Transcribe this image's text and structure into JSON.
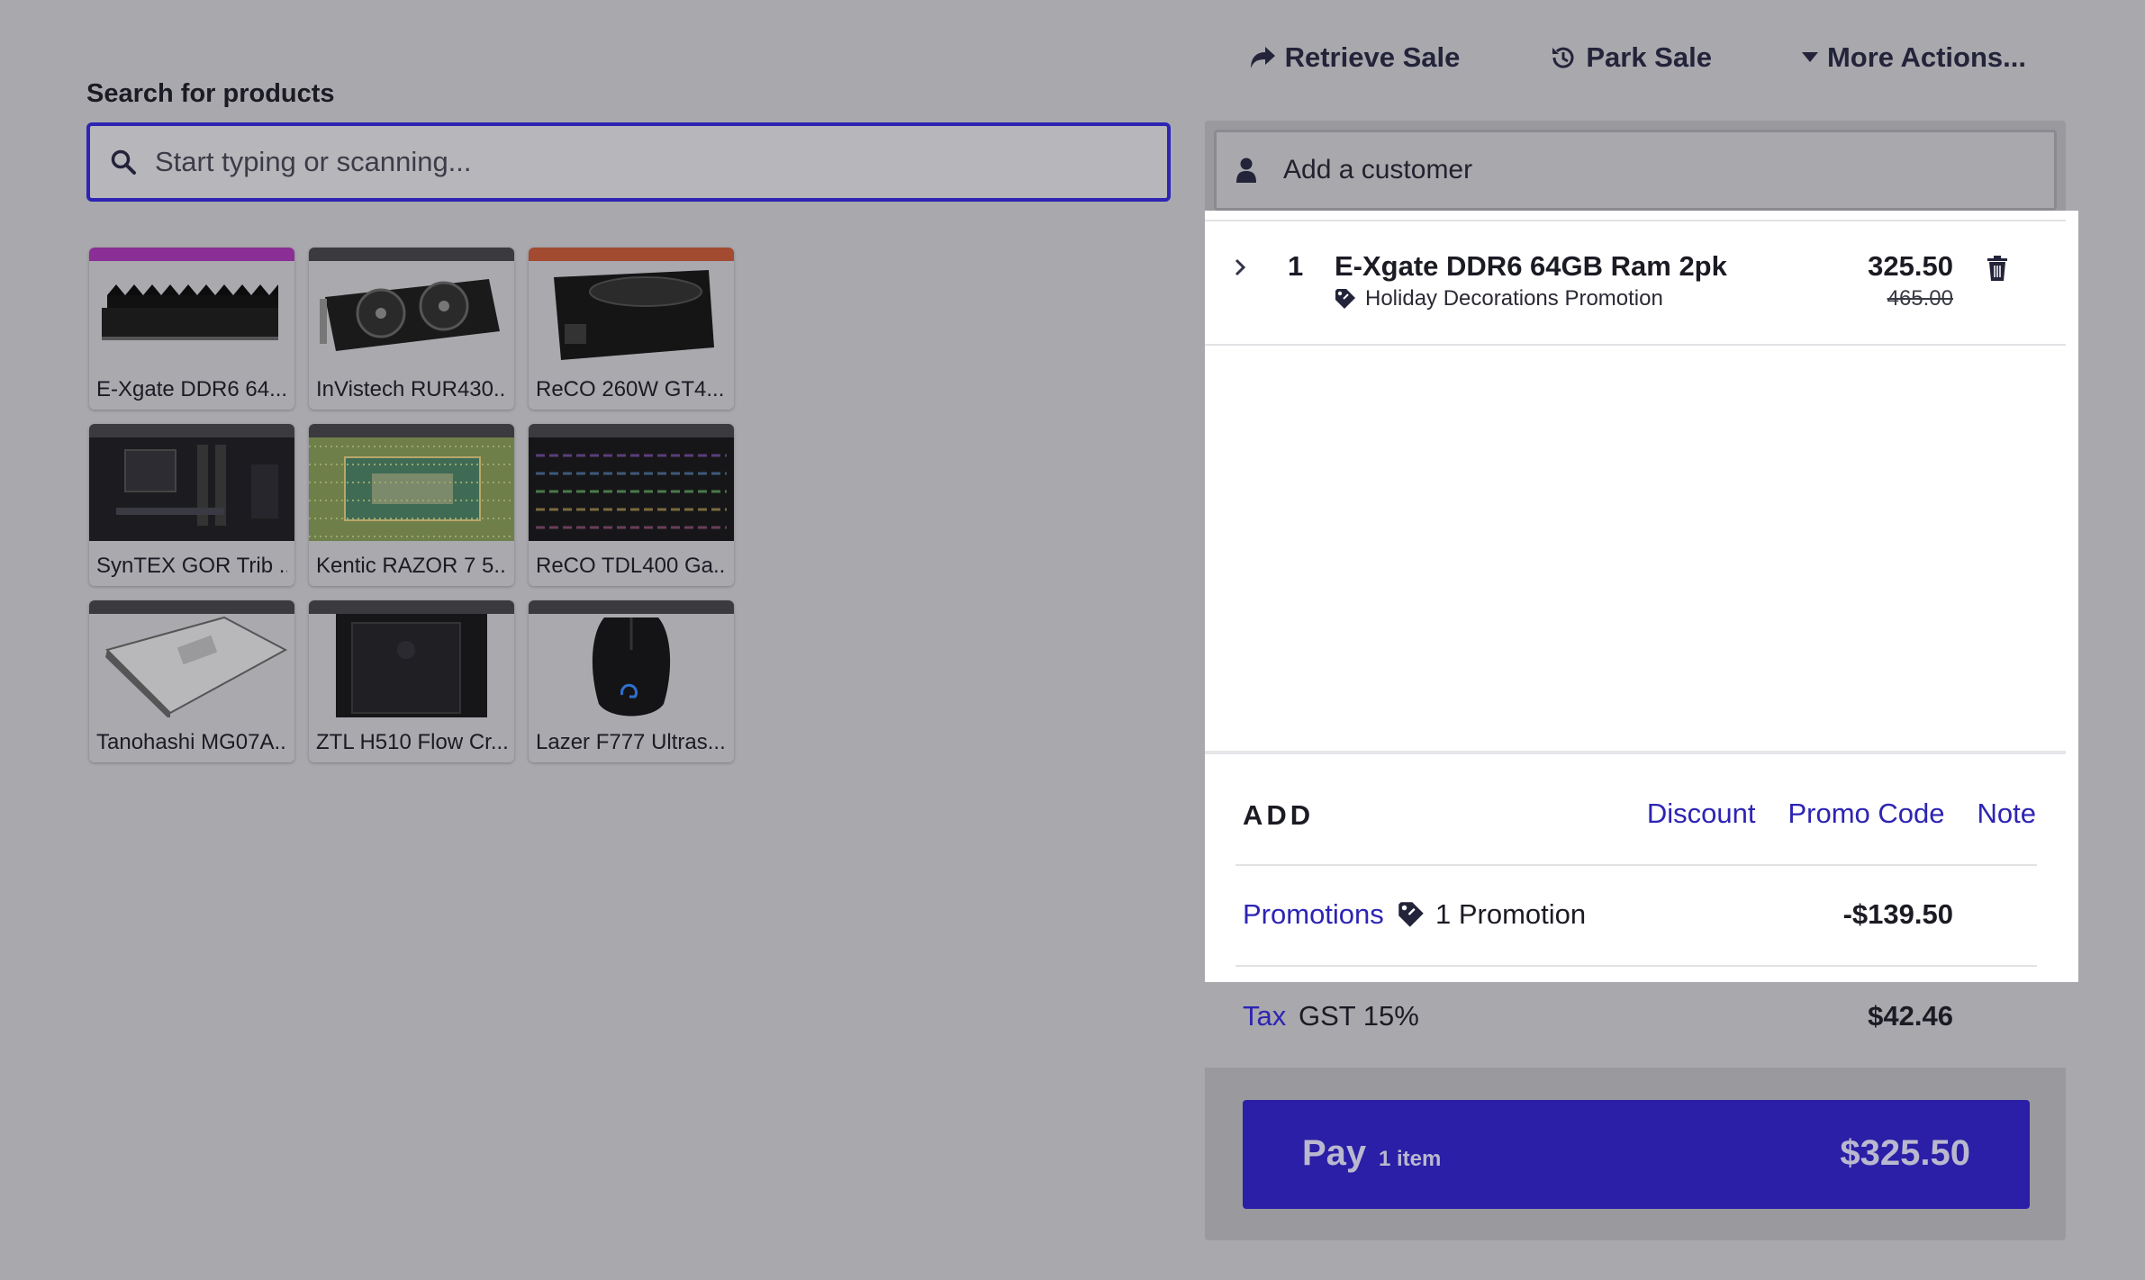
{
  "top_actions": {
    "retrieve": "Retrieve Sale",
    "park": "Park Sale",
    "more": "More Actions..."
  },
  "search": {
    "label": "Search for products",
    "placeholder": "Start typing or scanning..."
  },
  "products": [
    {
      "name": "E-Xgate DDR6 64...",
      "color": "#8a2f95",
      "icon": "ram-image"
    },
    {
      "name": "InVistech RUR430...",
      "color": "#3a3a3f",
      "icon": "gpu-image"
    },
    {
      "name": "ReCO 260W GT4...",
      "color": "#a24b30",
      "icon": "psu-image"
    },
    {
      "name": "SynTEX GOR Trib ...",
      "color": "#3a3a3f",
      "icon": "motherboard-image"
    },
    {
      "name": "Kentic RAZOR 7 5...",
      "color": "#3a3a3f",
      "icon": "cpu-image"
    },
    {
      "name": "ReCO TDL400 Ga...",
      "color": "#3a3a3f",
      "icon": "keyboard-image"
    },
    {
      "name": "Tanohashi MG07A...",
      "color": "#3a3a3f",
      "icon": "hdd-image"
    },
    {
      "name": "ZTL H510 Flow Cr...",
      "color": "#3a3a3f",
      "icon": "case-image"
    },
    {
      "name": "Lazer F777 Ultras...",
      "color": "#3a3a3f",
      "icon": "mouse-image"
    }
  ],
  "customer": {
    "placeholder": "Add a customer"
  },
  "cart": {
    "line": {
      "qty": "1",
      "name": "E-Xgate DDR6 64GB Ram 2pk",
      "promotion": "Holiday Decorations Promotion",
      "price": "325.50",
      "original_price": "465.00"
    },
    "add": {
      "label": "ADD",
      "discount": "Discount",
      "promo_code": "Promo Code",
      "note": "Note"
    },
    "promotions": {
      "label": "Promotions",
      "count": "1 Promotion",
      "amount": "-$139.50"
    },
    "tax": {
      "label": "Tax",
      "name": "GST 15%",
      "amount": "$42.46"
    },
    "pay": {
      "label": "Pay",
      "count": "1 item",
      "total": "$325.50"
    }
  },
  "colors": {
    "accent": "#2d24b3",
    "pay_button": "#2a1fa6",
    "overlay_bg": "#a9a8ad"
  }
}
